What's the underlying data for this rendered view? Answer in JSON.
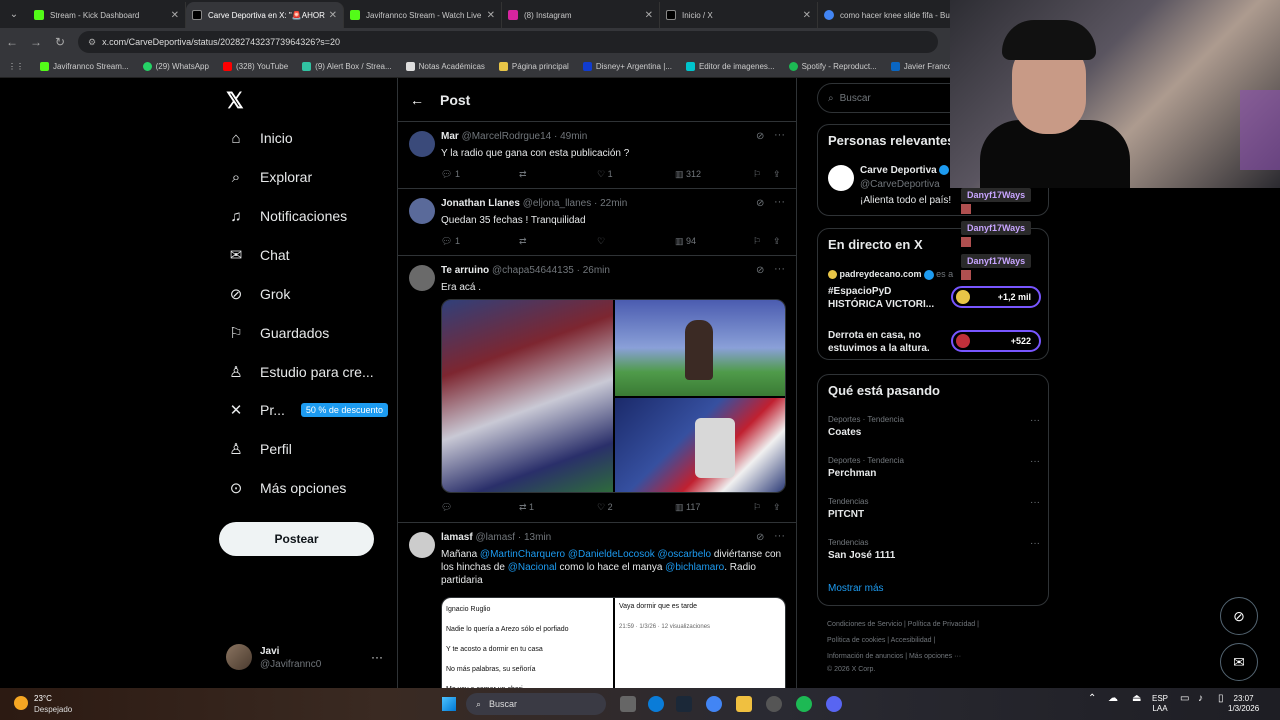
{
  "browser": {
    "tabs": [
      {
        "title": "Stream - Kick Dashboard",
        "color": "#53fc18"
      },
      {
        "title": "Carve Deportiva en X: \"🚨AHORA:",
        "color": "#000000"
      },
      {
        "title": "Javifrannco Stream - Watch Live",
        "color": "#53fc18"
      },
      {
        "title": "(8) Instagram",
        "color": "#d6249f"
      },
      {
        "title": "Inicio / X",
        "color": "#000000"
      },
      {
        "title": "como hacer knee slide fifa - Bu",
        "color": "#4285f4"
      }
    ],
    "url": "x.com/CarveDeportiva/status/2028274323773964326?s=20",
    "bookmarks": [
      {
        "label": "Javifrannco Stream...",
        "color": "#53fc18"
      },
      {
        "label": "(29) WhatsApp",
        "color": "#25d366"
      },
      {
        "label": "(328) YouTube",
        "color": "#ff0000"
      },
      {
        "label": "(9) Alert Box / Strea...",
        "color": "#31c3a2"
      },
      {
        "label": "Notas Académicas",
        "color": "#dddddd"
      },
      {
        "label": "Página principal",
        "color": "#e8c547"
      },
      {
        "label": "Disney+ Argentina |...",
        "color": "#113ccf"
      },
      {
        "label": "Editor de imagenes...",
        "color": "#00c4cc"
      },
      {
        "label": "Spotify - Reproduct...",
        "color": "#1db954"
      },
      {
        "label": "Javier Franco | Li",
        "color": "#0a66c2"
      }
    ]
  },
  "sidebar": {
    "items": [
      {
        "label": "Inicio",
        "icon": "home-icon",
        "glyph": "⌂"
      },
      {
        "label": "Explorar",
        "icon": "search-icon",
        "glyph": "⌕"
      },
      {
        "label": "Notificaciones",
        "icon": "bell-icon",
        "glyph": "🔔︎"
      },
      {
        "label": "Chat",
        "icon": "mail-icon",
        "glyph": "✉"
      },
      {
        "label": "Grok",
        "icon": "grok-icon",
        "glyph": "⊘"
      },
      {
        "label": "Guardados",
        "icon": "bookmark-icon",
        "glyph": "⌑"
      },
      {
        "label": "Estudio para cre...",
        "icon": "studio-icon",
        "glyph": "♙"
      },
      {
        "label": "Pr...",
        "icon": "x-premium-icon",
        "glyph": "𝕏"
      },
      {
        "label": "Perfil",
        "icon": "person-icon",
        "glyph": "♙"
      },
      {
        "label": "Más opciones",
        "icon": "more-circle-icon",
        "glyph": "⊙"
      }
    ],
    "premium_badge": "50 % de descuento",
    "post_button": "Postear",
    "account_name": "Javi",
    "account_handle": "@Javifrannc0"
  },
  "center": {
    "title": "Post",
    "replies": [
      {
        "name": "Mar",
        "handle": "@MarcelRodrgue14",
        "time": "· 49min",
        "text": "Y la radio que gana con esta publicación ?",
        "replies": "1",
        "reposts": "",
        "likes": "1",
        "views": "312",
        "avatar": "#3a4a7a"
      },
      {
        "name": "Jonathan Llanes",
        "handle": "@eljona_llanes",
        "time": "· 22min",
        "text": "Quedan 35 fechas ! Tranquilidad",
        "replies": "1",
        "reposts": "",
        "likes": "",
        "views": "94",
        "avatar": "#5a6a9a"
      },
      {
        "name": "Te arruino",
        "handle": "@chapa54644135",
        "time": "· 26min",
        "text": "Era acá .",
        "replies": "",
        "reposts": "1",
        "likes": "2",
        "views": "117",
        "avatar": "#6a6a6a"
      },
      {
        "name": "lamasf",
        "handle": "@lamasf",
        "time": "· 13min",
        "text": "",
        "replies": "",
        "reposts": "",
        "likes": "",
        "views": "",
        "avatar": "#cccccc"
      }
    ],
    "lamasf_text": {
      "p1": "Mañana ",
      "m1": "@MartinCharquero",
      "m2": "@DanieldeLocosok",
      "m3": "@oscarbelo",
      "p2": " diviértanse con los hinchas de ",
      "m4": "@Nacional",
      "p3": " como lo hace el manya ",
      "m5": "@bichlamaro",
      "p4": ". Radio partidaria"
    },
    "screenshot_left": [
      "Ignacio Ruglio",
      "Nadie lo quería a Arezo sólo el porfiado",
      "Y te  acosto  a dormir en tu casa",
      "No más palabras, su señoría",
      "Me voy a comer un chori"
    ],
    "screenshot_right": [
      "Vaya dormir que es tarde",
      "21:59 · 1/3/26 · 12 visualizaciones"
    ]
  },
  "right": {
    "search_placeholder": "Buscar",
    "relevant": {
      "title": "Personas relevantes",
      "name": "Carve Deportiva",
      "handle": "@CarveDeportiva",
      "bio": "¡Alienta todo el país!"
    },
    "live": {
      "title": "En directo en X",
      "host": "padreydecano.com",
      "host_suffix": "es a",
      "items": [
        {
          "title": "#EspacioPyD HISTÓRICA VICTORI...",
          "count": "+1,2 mil"
        },
        {
          "title": "Derrota en casa, no estuvimos a la altura.",
          "count": "+522"
        }
      ]
    },
    "trends": {
      "title": "Qué está pasando",
      "items": [
        {
          "category": "Deportes · Tendencia",
          "name": "Coates"
        },
        {
          "category": "Deportes · Tendencia",
          "name": "Perchman"
        },
        {
          "category": "Tendencias",
          "name": "PITCNT"
        },
        {
          "category": "Tendencias",
          "name": "San José 1111"
        }
      ],
      "show_more": "Mostrar más"
    },
    "footer": [
      "Condiciones de Servicio  |  Política de Privacidad  |",
      "Política de cookies  |  Accesibilidad  |",
      "Información de anuncios  |  Más opciones ···",
      "© 2026 X Corp."
    ]
  },
  "overlay": {
    "chat_user": "Danyf17Ways"
  },
  "taskbar": {
    "temp": "23°C",
    "weather": "Despejado",
    "search": "Buscar",
    "lang1": "ESP",
    "lang2": "LAA",
    "time": "23:07",
    "date": "1/3/2026"
  }
}
